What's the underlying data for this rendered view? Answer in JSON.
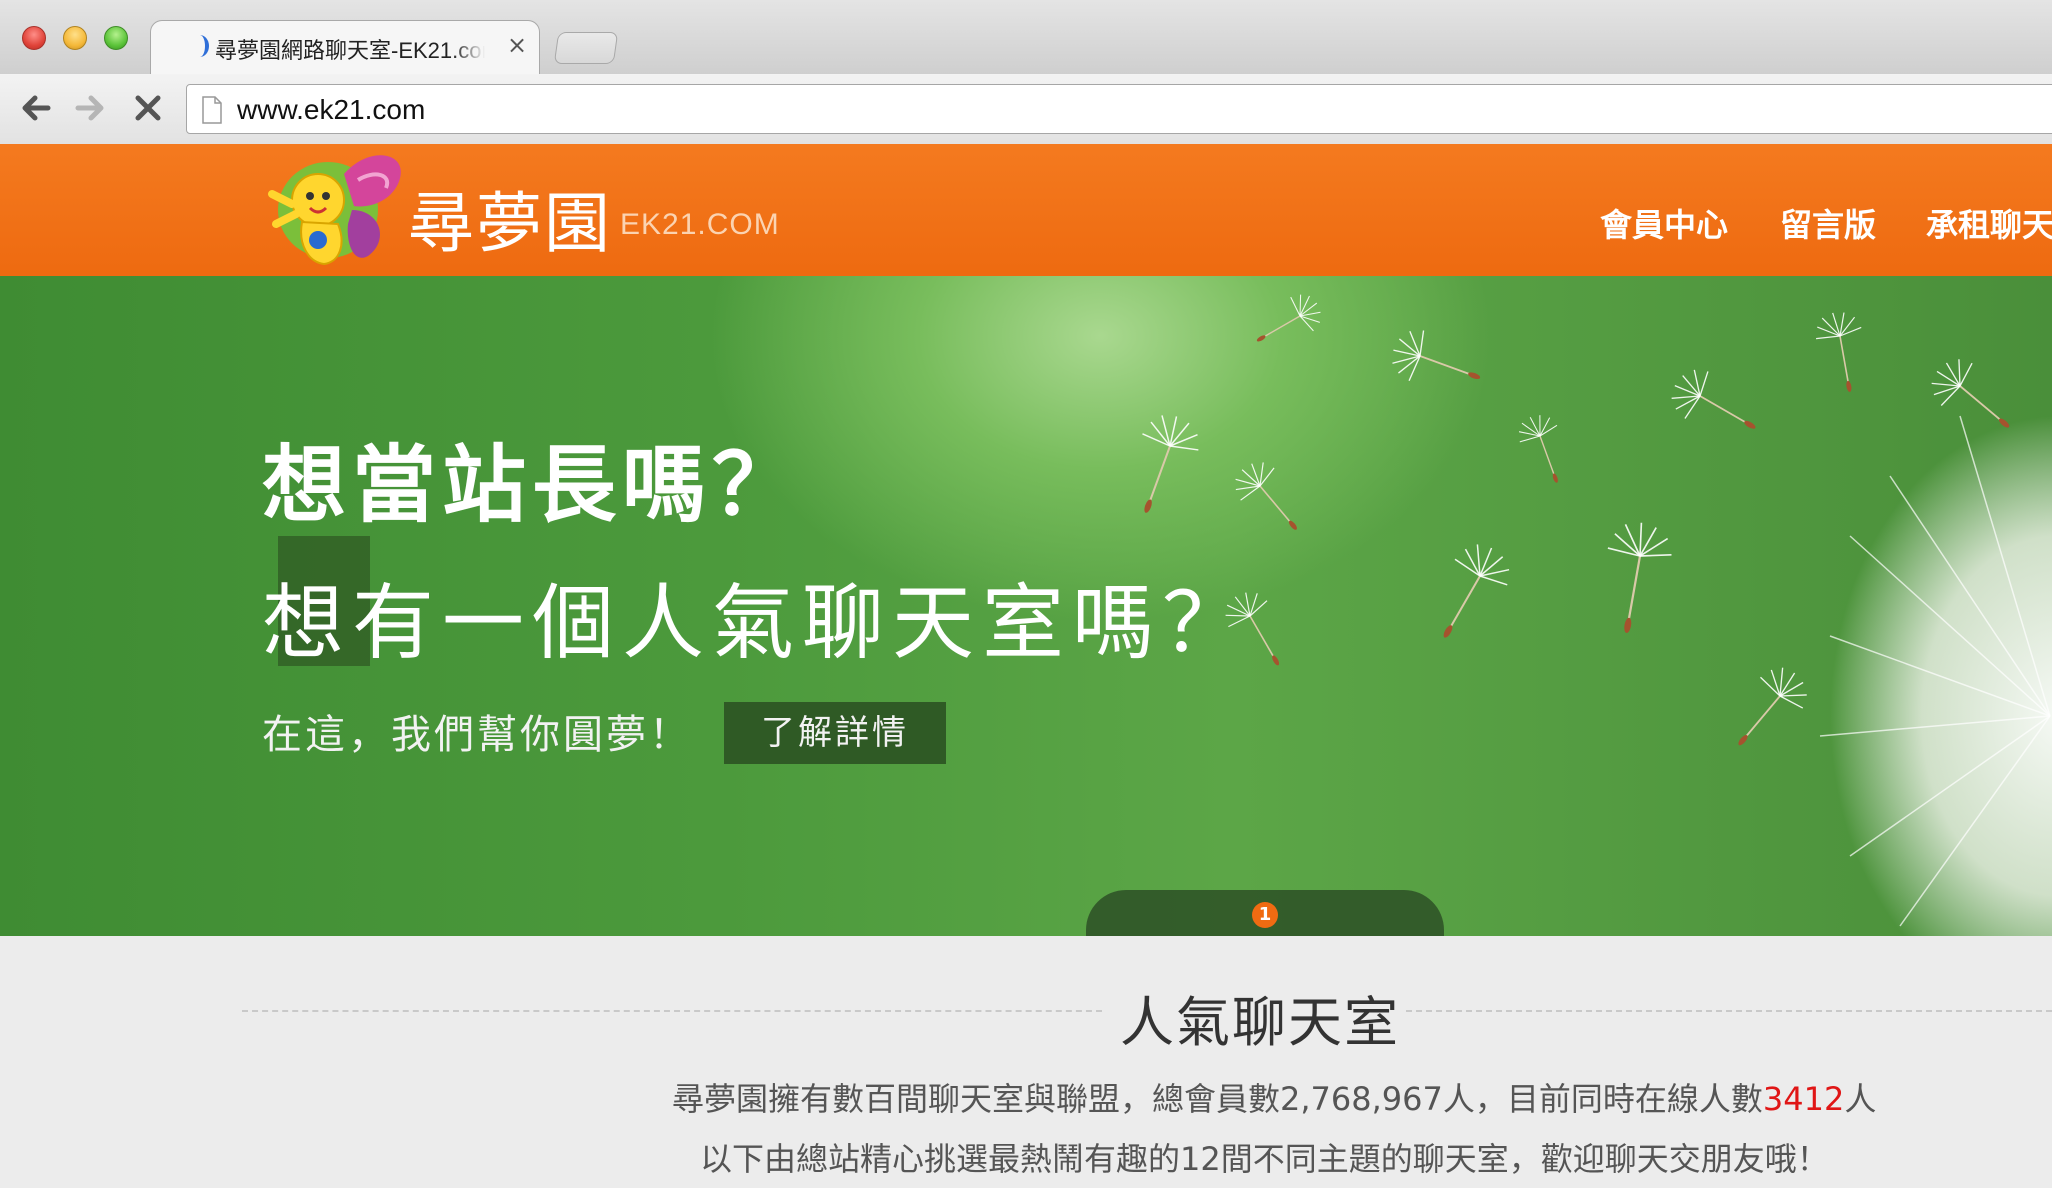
{
  "browser": {
    "tab_title": "尋夢園網路聊天室-EK21.com",
    "tab_close": "×",
    "url": "www.ek21.com"
  },
  "header": {
    "brand": "尋夢園",
    "domain": "EK21.COM",
    "nav": [
      "會員中心",
      "留言版",
      "承租聊天"
    ]
  },
  "hero": {
    "headline": "想當站長嗎？",
    "subheadline": "想有一個人氣聊天室嗎？",
    "tagline": "在這，我們幫你圓夢！",
    "cta": "了解詳情",
    "slide_number": "1"
  },
  "section": {
    "title": "人氣聊天室",
    "line1_prefix": "尋夢園擁有數百間聊天室與聯盟，總會員數2,768,967人，目前同時在線人數",
    "online_count": "3412",
    "line1_suffix": "人",
    "line2": "以下由總站精心挑選最熱鬧有趣的12間不同主題的聊天室，歡迎聊天交朋友哦！"
  },
  "colors": {
    "header_orange": "#f06b12",
    "hero_green": "#4c9a3c",
    "cta_dark_green": "#2f5a25",
    "online_red": "#e01616"
  },
  "icons": [
    "back-arrow-icon",
    "forward-arrow-icon",
    "stop-icon",
    "page-icon",
    "butterfly-mascot-logo"
  ]
}
